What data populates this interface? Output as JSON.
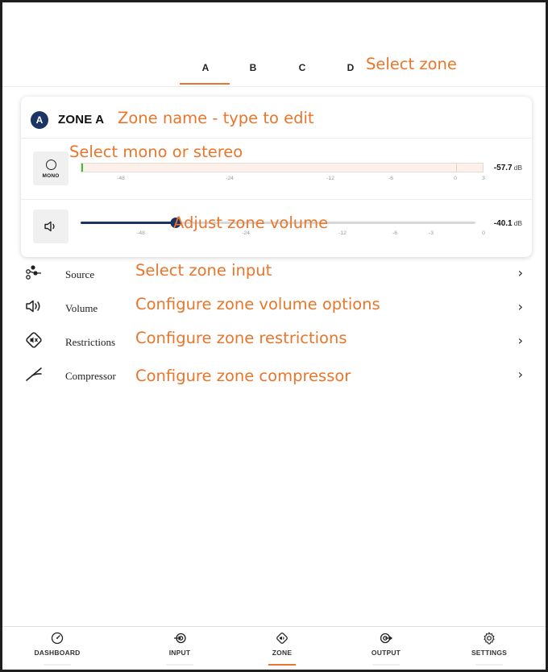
{
  "tabs": [
    {
      "label": "A",
      "active": true
    },
    {
      "label": "B",
      "active": false
    },
    {
      "label": "C",
      "active": false
    },
    {
      "label": "D",
      "active": false
    }
  ],
  "zone": {
    "badge": "A",
    "name": "ZONE A",
    "mono_label": "MONO",
    "meter": {
      "level_db": -57.7,
      "readout": "-57.7",
      "unit": "dB",
      "scale_ticks": [
        "-48",
        "-24",
        "-12",
        "-6",
        "0",
        "3"
      ]
    },
    "volume": {
      "level_db": -40.1,
      "readout": "-40.1",
      "unit": "dB",
      "scale_ticks": [
        "-48",
        "-24",
        "-12",
        "-6",
        "-3",
        "0"
      ]
    }
  },
  "menu": [
    {
      "label": "Source",
      "icon": "source-icon"
    },
    {
      "label": "Volume",
      "icon": "speaker-icon"
    },
    {
      "label": "Restrictions",
      "icon": "restrictions-icon"
    },
    {
      "label": "Compressor",
      "icon": "compressor-icon"
    }
  ],
  "chevron": "›",
  "nav": [
    {
      "label": "DASHBOARD",
      "icon": "gauge-icon",
      "active": false
    },
    {
      "label": "INPUT",
      "icon": "input-icon",
      "active": false
    },
    {
      "label": "ZONE",
      "icon": "zone-icon",
      "active": true
    },
    {
      "label": "OUTPUT",
      "icon": "output-icon",
      "active": false
    },
    {
      "label": "SETTINGS",
      "icon": "gear-icon",
      "active": false
    }
  ],
  "annotations": {
    "select_zone": "Select zone",
    "zone_name": "Zone name - type to edit",
    "mono_stereo": "Select mono or stereo",
    "adjust_volume": "Adjust zone volume",
    "select_input": "Select zone input",
    "volume_options": "Configure zone volume options",
    "restrictions": "Configure zone restrictions",
    "compressor": "Configure zone compressor"
  },
  "colors": {
    "accent": "#e8762b",
    "primary": "#1c3464",
    "meter_signal": "#35c435"
  }
}
